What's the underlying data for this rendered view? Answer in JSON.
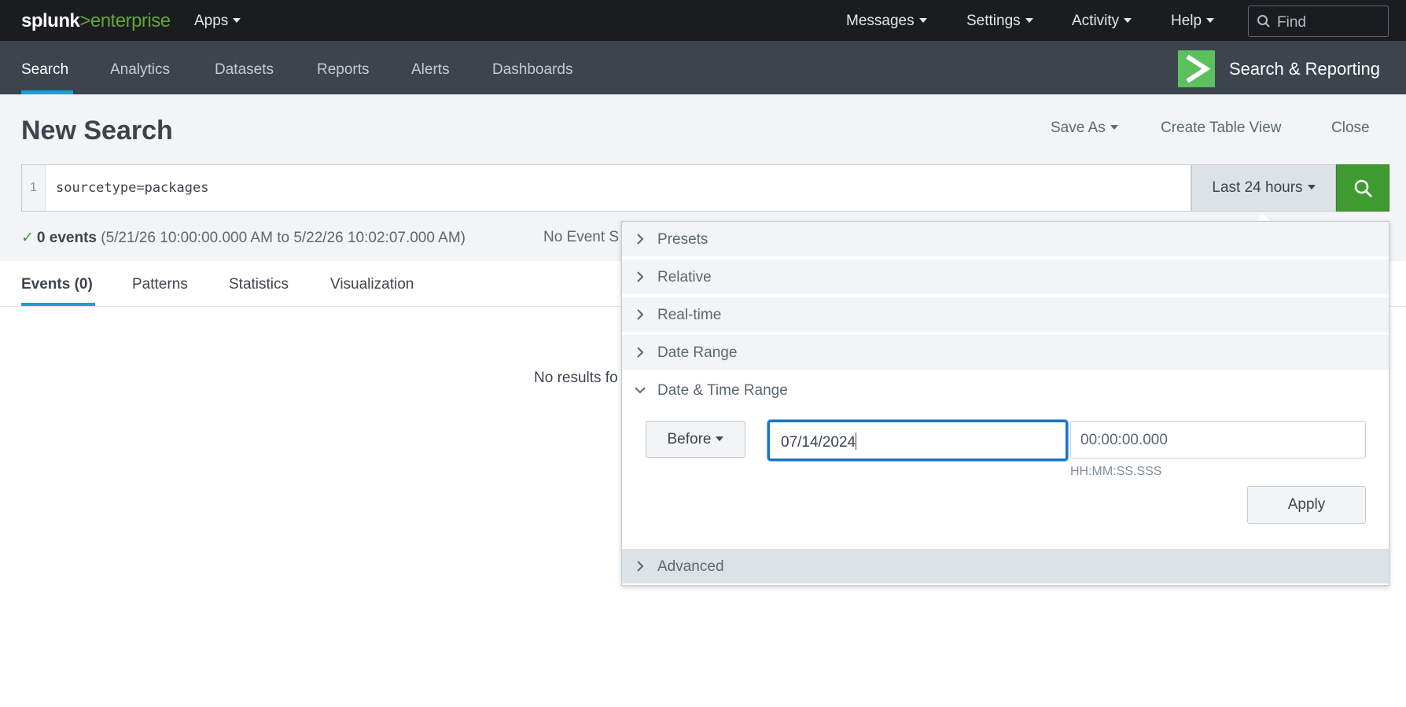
{
  "topbar": {
    "logo": {
      "part1": "splunk",
      "part2": ">",
      "part3": "enterprise"
    },
    "apps_label": "Apps",
    "messages_label": "Messages",
    "settings_label": "Settings",
    "activity_label": "Activity",
    "help_label": "Help",
    "find_placeholder": "Find"
  },
  "appbar": {
    "nav": [
      "Search",
      "Analytics",
      "Datasets",
      "Reports",
      "Alerts",
      "Dashboards"
    ],
    "app_title": "Search & Reporting",
    "app_icon": "chevron-right-icon"
  },
  "header": {
    "title": "New Search",
    "save_as": "Save As",
    "create_table_view": "Create Table View",
    "close": "Close"
  },
  "search": {
    "line_number": "1",
    "query": "sourcetype=packages",
    "time_range_label": "Last 24 hours"
  },
  "status": {
    "events": "0 events",
    "range": "(5/21/26 10:00:00.000 AM to 5/22/26 10:02:07.000 AM)",
    "sampling": "No Event S"
  },
  "tabs": [
    "Events (0)",
    "Patterns",
    "Statistics",
    "Visualization"
  ],
  "results": {
    "message": "No results fo"
  },
  "time_picker": {
    "panels": [
      "Presets",
      "Relative",
      "Real-time",
      "Date Range",
      "Date & Time Range",
      "Advanced"
    ],
    "open_panel": "Date & Time Range",
    "mode_label": "Before",
    "date_value": "07/14/2024",
    "time_value": "00:00:00.000",
    "time_hint": "HH:MM:SS.SSS",
    "apply_label": "Apply"
  },
  "colors": {
    "topbar": "#1a1c20",
    "appbar": "#3c444d",
    "brand_green": "#65a637",
    "search_button": "#3f9b2f",
    "accent_blue": "#1a9cde",
    "focus_blue": "#1a73c9"
  }
}
